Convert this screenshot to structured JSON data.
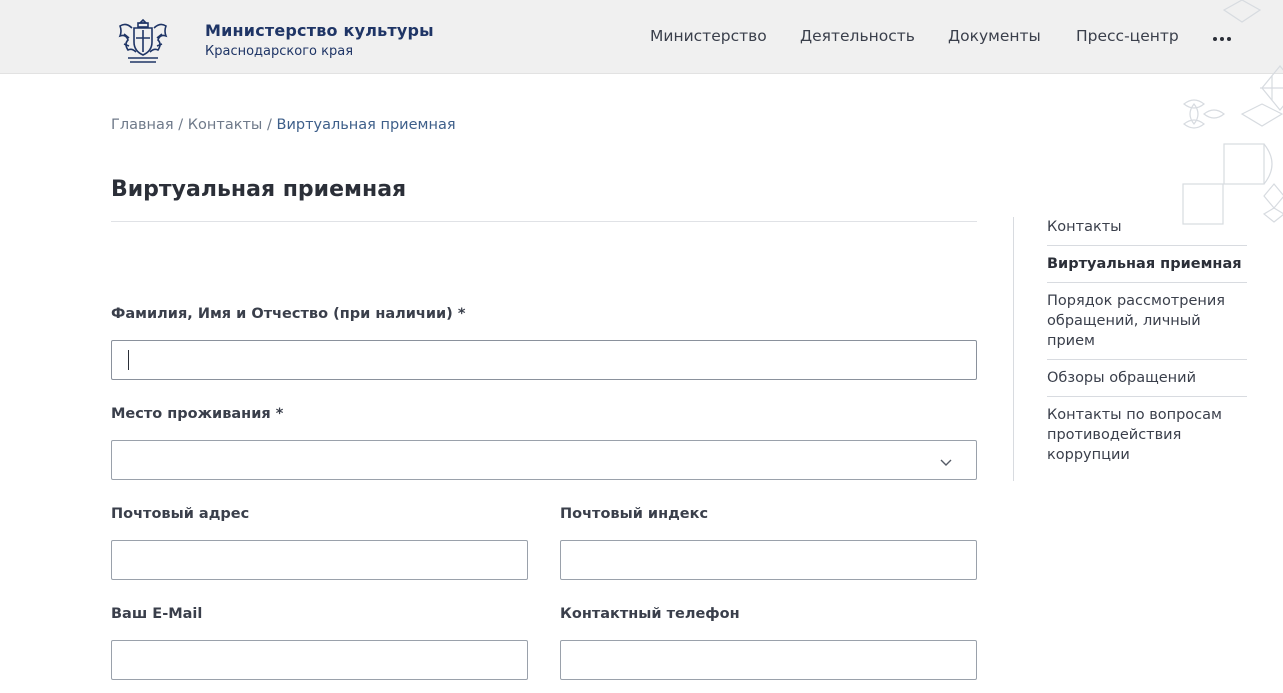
{
  "header": {
    "org_title": "Министерство культуры",
    "org_subtitle": "Краснодарского края",
    "nav": [
      {
        "label": "Министерство"
      },
      {
        "label": "Деятельность"
      },
      {
        "label": "Документы"
      },
      {
        "label": "Пресс-центр"
      }
    ],
    "more_icon": "more-dots-icon",
    "logo_icon": "coat-of-arms-icon"
  },
  "breadcrumb": {
    "home": "Главная",
    "separator": "/",
    "contacts": "Контакты",
    "current": "Виртуальная приемная"
  },
  "page": {
    "title": "Виртуальная приемная"
  },
  "form": {
    "full_name_label": "Фамилия, Имя и Отчество (при наличии) *",
    "full_name_value": "",
    "residence_label": "Место проживания *",
    "residence_value": "",
    "postal_address_label": "Почтовый адрес",
    "postal_address_value": "",
    "postal_code_label": "Почтовый индекс",
    "postal_code_value": "",
    "email_label": "Ваш E-Mail",
    "email_value": "",
    "phone_label": "Контактный телефон",
    "phone_value": ""
  },
  "sidebar": {
    "items": [
      {
        "label": "Контакты"
      },
      {
        "label": "Виртуальная приемная"
      },
      {
        "label": "Порядок рассмотрения обращений, личный прием"
      },
      {
        "label": "Обзоры обращений"
      },
      {
        "label": "Контакты по вопросам противодействия коррупции"
      }
    ]
  },
  "colors": {
    "header_bg": "#f0f0f0",
    "brand": "#1f3566",
    "breadcrumb_current": "#3e5f8a",
    "text": "#2b2f38"
  }
}
